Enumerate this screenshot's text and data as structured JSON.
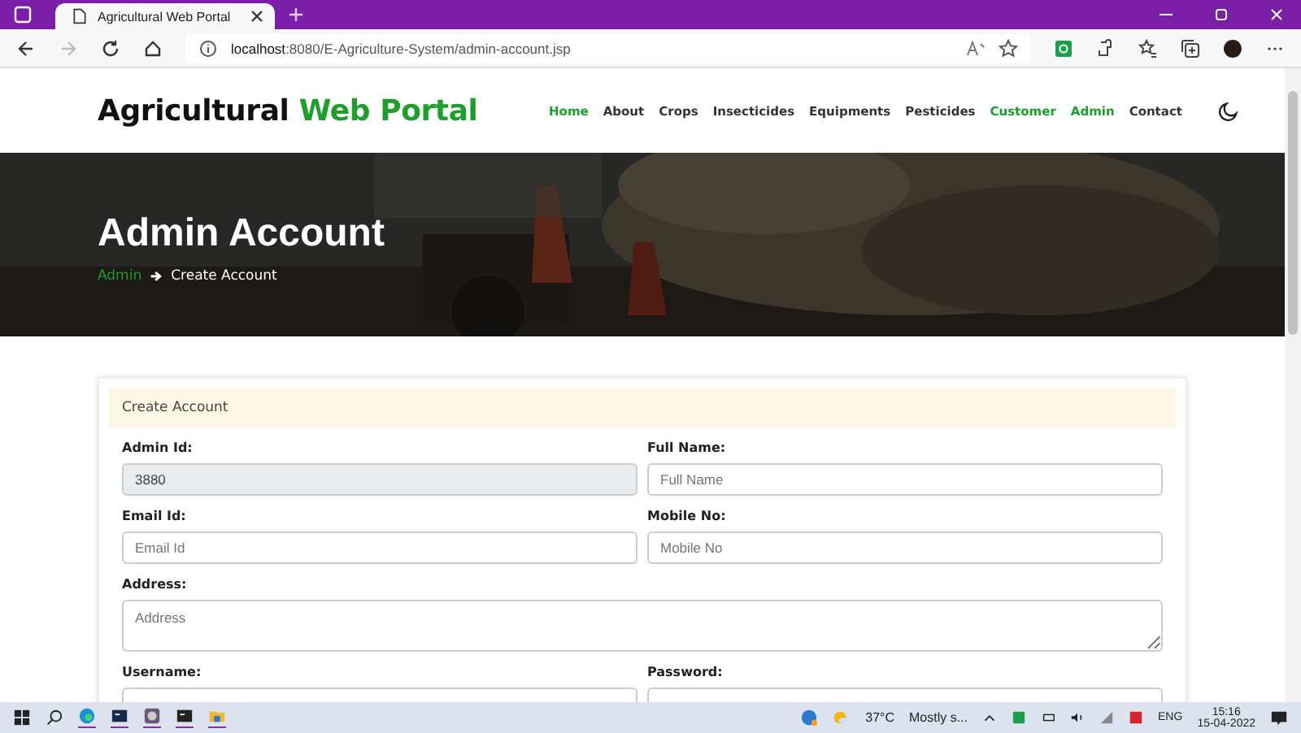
{
  "browser": {
    "tab_title": "Agricultural Web Portal",
    "url_host": "localhost",
    "url_path": ":8080/E-Agriculture-System/admin-account.jsp"
  },
  "site": {
    "brand": "Agricultural",
    "brand_accent": "Web Portal",
    "nav": [
      {
        "label": "Home",
        "active": true
      },
      {
        "label": "About",
        "active": false
      },
      {
        "label": "Crops",
        "active": false
      },
      {
        "label": "Insecticides",
        "active": false
      },
      {
        "label": "Equipments",
        "active": false
      },
      {
        "label": "Pesticides",
        "active": false
      },
      {
        "label": "Customer",
        "active": true
      },
      {
        "label": "Admin",
        "active": true
      },
      {
        "label": "Contact",
        "active": false
      }
    ]
  },
  "hero": {
    "title": "Admin Account",
    "breadcrumb": [
      "Admin",
      "Create Account"
    ]
  },
  "form": {
    "header": "Create Account",
    "fields": [
      {
        "label": "Admin Id:",
        "kind": "input",
        "value": "3880",
        "disabled": true
      },
      {
        "label": "Full Name:",
        "kind": "input",
        "placeholder": "Full Name",
        "disabled": false
      },
      {
        "label": "Email Id:",
        "kind": "input",
        "placeholder": "Email Id",
        "disabled": false
      },
      {
        "label": "Mobile No:",
        "kind": "input",
        "placeholder": "Mobile No",
        "disabled": false
      },
      {
        "label": "Address:",
        "kind": "textarea",
        "placeholder": "Address",
        "disabled": false
      },
      {
        "label": "Username:",
        "kind": "input",
        "disabled": false
      },
      {
        "label": "Password:",
        "kind": "input",
        "disabled": false
      }
    ]
  },
  "taskbar": {
    "temperature": "37°C",
    "weather": "Mostly s...",
    "language": "ENG",
    "time": "15:16",
    "date": "15-04-2022"
  }
}
